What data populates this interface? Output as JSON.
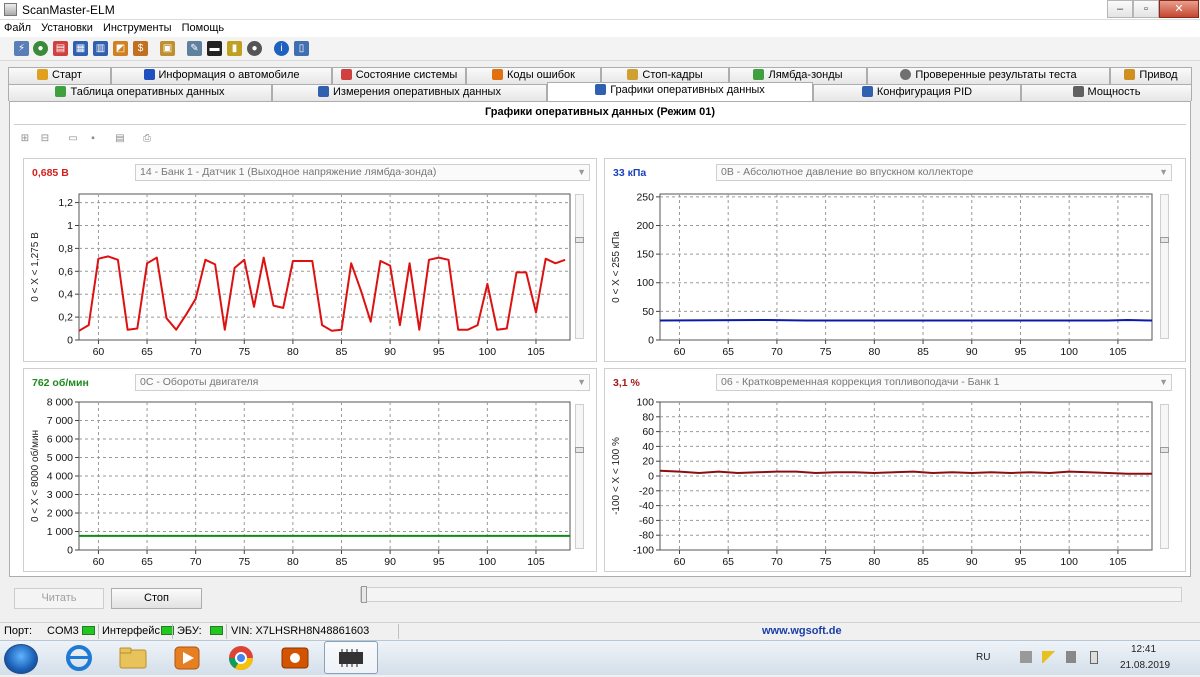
{
  "window": {
    "title": "ScanMaster-ELM"
  },
  "menu": [
    "Файл",
    "Установки",
    "Инструменты",
    "Помощь"
  ],
  "tabs_row1": [
    {
      "label": "Старт",
      "icon": "home-icon",
      "color": "#e0a020"
    },
    {
      "label": "Информация о автомобиле",
      "icon": "info-icon",
      "color": "#2050c0"
    },
    {
      "label": "Состояние системы",
      "icon": "system-status-icon",
      "color": "#d04040"
    },
    {
      "label": "Коды ошибок",
      "icon": "warning-icon",
      "color": "#e07010"
    },
    {
      "label": "Стоп-кадры",
      "icon": "freeze-frame-icon",
      "color": "#d0a030"
    },
    {
      "label": "Лямбда-зонды",
      "icon": "lambda-icon",
      "color": "#40a040"
    },
    {
      "label": "Проверенные результаты теста",
      "icon": "gear-icon",
      "color": "#707070"
    },
    {
      "label": "Привод",
      "icon": "drive-icon",
      "color": "#d09020"
    }
  ],
  "tabs_row2": [
    {
      "label": "Таблица оперативных данных",
      "icon": "table-icon",
      "color": "#40a040"
    },
    {
      "label": "Измерения оперативных данных",
      "icon": "measure-icon",
      "color": "#3060b0"
    },
    {
      "label": "Графики оперативных данных",
      "icon": "chart-icon",
      "color": "#3060b0",
      "active": true
    },
    {
      "label": "Конфигурация PID",
      "icon": "config-icon",
      "color": "#3060b0"
    },
    {
      "label": "Мощность",
      "icon": "power-icon",
      "color": "#606060"
    }
  ],
  "panel": {
    "title": "Графики оперативных данных (Режим 01)"
  },
  "charts": [
    {
      "value": "0,685 В",
      "value_color": "#d42020",
      "sensor": "14 - Банк 1 - Датчик 1 (Выходное напряжение лямбда-зонда)",
      "range_label": "0   < X <   1,275 В",
      "line_color": "#dd1111",
      "y_ticks": [
        "1,2",
        "1",
        "0,8",
        "0,6",
        "0,4",
        "0,2",
        "0"
      ],
      "y_min": 0,
      "y_max": 1.275,
      "x_ticks": [
        "60",
        "65",
        "70",
        "75",
        "80",
        "85",
        "90",
        "95",
        "100",
        "105"
      ]
    },
    {
      "value": "33 кПа",
      "value_color": "#1a3fbf",
      "sensor": "0B - Абсолютное давление во впускном коллекторе",
      "range_label": "0   < X <   255 кПа",
      "line_color": "#0a1aa6",
      "y_ticks": [
        "250",
        "200",
        "150",
        "100",
        "50",
        "0"
      ],
      "y_min": 0,
      "y_max": 255,
      "x_ticks": [
        "60",
        "65",
        "70",
        "75",
        "80",
        "85",
        "90",
        "95",
        "100",
        "105"
      ]
    },
    {
      "value": "762 об/мин",
      "value_color": "#1e8a1e",
      "sensor": "0C - Обороты двигателя",
      "range_label": "0   < X <   8000 об/мин",
      "line_color": "#11881a",
      "y_ticks": [
        "8 000",
        "7 000",
        "6 000",
        "5 000",
        "4 000",
        "3 000",
        "2 000",
        "1 000",
        "0"
      ],
      "y_min": 0,
      "y_max": 8000,
      "x_ticks": [
        "60",
        "65",
        "70",
        "75",
        "80",
        "85",
        "90",
        "95",
        "100",
        "105"
      ]
    },
    {
      "value": "3,1 %",
      "value_color": "#a01a1a",
      "sensor": "06 - Кратковременная коррекция топливоподачи - Банк 1",
      "range_label": "-100   < X <   100 %",
      "line_color": "#8a1010",
      "y_ticks": [
        "100",
        "80",
        "60",
        "40",
        "20",
        "0",
        "-20",
        "-40",
        "-60",
        "-80",
        "-100"
      ],
      "y_min": -100,
      "y_max": 100,
      "x_ticks": [
        "60",
        "65",
        "70",
        "75",
        "80",
        "85",
        "90",
        "95",
        "100",
        "105"
      ]
    }
  ],
  "chart_data": [
    {
      "type": "line",
      "x": [
        58,
        59,
        60,
        61,
        62,
        63,
        64,
        65,
        66,
        67,
        68,
        69,
        70,
        71,
        72,
        73,
        74,
        75,
        76,
        77,
        78,
        79,
        80,
        81,
        82,
        83,
        84,
        85,
        86,
        87,
        88,
        89,
        90,
        91,
        92,
        93,
        94,
        95,
        96,
        97,
        98,
        99,
        100,
        101,
        102,
        103,
        104,
        105,
        106,
        107,
        108
      ],
      "values": [
        0.08,
        0.13,
        0.71,
        0.73,
        0.7,
        0.09,
        0.1,
        0.67,
        0.72,
        0.19,
        0.09,
        0.22,
        0.36,
        0.7,
        0.66,
        0.09,
        0.63,
        0.7,
        0.29,
        0.72,
        0.3,
        0.28,
        0.69,
        0.69,
        0.69,
        0.13,
        0.08,
        0.09,
        0.67,
        0.43,
        0.16,
        0.69,
        0.65,
        0.13,
        0.67,
        0.09,
        0.7,
        0.72,
        0.7,
        0.09,
        0.09,
        0.13,
        0.49,
        0.09,
        0.1,
        0.59,
        0.59,
        0.24,
        0.71,
        0.67,
        0.7
      ],
      "xlim": [
        58,
        108.5
      ],
      "ylim": [
        0,
        1.275
      ],
      "grid": true
    },
    {
      "type": "line",
      "x": [
        58,
        69,
        73,
        104,
        106,
        108.5
      ],
      "values": [
        34,
        35,
        34,
        34,
        35,
        34
      ],
      "xlim": [
        58,
        108.5
      ],
      "ylim": [
        0,
        255
      ],
      "grid": true
    },
    {
      "type": "line",
      "x": [
        58,
        108.5
      ],
      "values": [
        762,
        762
      ],
      "xlim": [
        58,
        108.5
      ],
      "ylim": [
        0,
        8000
      ],
      "grid": true
    },
    {
      "type": "line",
      "x": [
        58,
        60,
        62,
        64,
        66,
        68,
        70,
        72,
        74,
        76,
        78,
        80,
        82,
        84,
        86,
        88,
        90,
        92,
        94,
        96,
        98,
        100,
        102,
        104,
        106,
        108.5
      ],
      "values": [
        7,
        6,
        4,
        6,
        4,
        5,
        6,
        6,
        4,
        5,
        5,
        4,
        5,
        6,
        4,
        5,
        4,
        5,
        4,
        5,
        4,
        6,
        5,
        4,
        3,
        3
      ],
      "xlim": [
        58,
        108.5
      ],
      "ylim": [
        -100,
        100
      ],
      "grid": true
    }
  ],
  "buttons": {
    "read": "Читать",
    "stop": "Стоп"
  },
  "status": {
    "port_label": "Порт:",
    "port_value": "COM3",
    "interface_label": "Интерфейс:",
    "ecu_label": "ЭБУ:",
    "vin": "VIN: X7LHSRH8N48861603",
    "site": "www.wgsoft.de"
  },
  "taskbar": {
    "lang": "RU",
    "time": "12:41",
    "date": "21.08.2019"
  }
}
